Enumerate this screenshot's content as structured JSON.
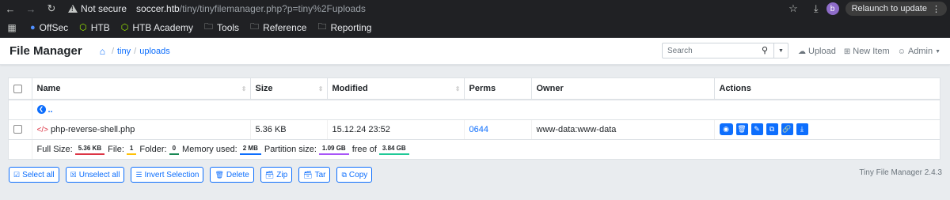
{
  "browser": {
    "not_secure_label": "Not secure",
    "url_host": "soccer.htb",
    "url_path": "/tiny/tinyfilemanager.php?p=tiny%2Fuploads",
    "profile_initial": "b",
    "relaunch_label": "Relaunch to update"
  },
  "bookmarks": [
    {
      "label": "OffSec",
      "icon": "offsec-icon"
    },
    {
      "label": "HTB",
      "icon": "htb-cube-icon"
    },
    {
      "label": "HTB Academy",
      "icon": "htb-cube-icon"
    },
    {
      "label": "Tools",
      "icon": "folder-icon"
    },
    {
      "label": "Reference",
      "icon": "folder-icon"
    },
    {
      "label": "Reporting",
      "icon": "folder-icon"
    }
  ],
  "app": {
    "title": "File Manager",
    "breadcrumb": [
      "tiny",
      "uploads"
    ],
    "search_placeholder": "Search",
    "upload_label": "Upload",
    "new_item_label": "New Item",
    "user_label": "Admin"
  },
  "table": {
    "headers": {
      "name": "Name",
      "size": "Size",
      "modified": "Modified",
      "perms": "Perms",
      "owner": "Owner",
      "actions": "Actions"
    },
    "parent_label": "..",
    "rows": [
      {
        "name": "php-reverse-shell.php",
        "size": "5.36 KB",
        "modified": "15.12.24 23:52",
        "perms": "0644",
        "owner": "www-data:www-data"
      }
    ],
    "summary": {
      "full_size_label": "Full Size:",
      "full_size": "5.36 KB",
      "file_label": "File:",
      "file_count": "1",
      "folder_label": "Folder:",
      "folder_count": "0",
      "memory_label": "Memory used:",
      "memory": "2 MB",
      "partition_label": "Partition size:",
      "partition": "1.09 GB",
      "free_label": "free of",
      "total": "3.84 GB"
    }
  },
  "bottom_buttons": {
    "select_all": "Select all",
    "unselect_all": "Unselect all",
    "invert": "Invert Selection",
    "delete": "Delete",
    "zip": "Zip",
    "tar": "Tar",
    "copy": "Copy"
  },
  "version": "Tiny File Manager 2.4.3",
  "colors": {
    "accent": "#0d6efd",
    "chrome_bg": "#202124"
  }
}
